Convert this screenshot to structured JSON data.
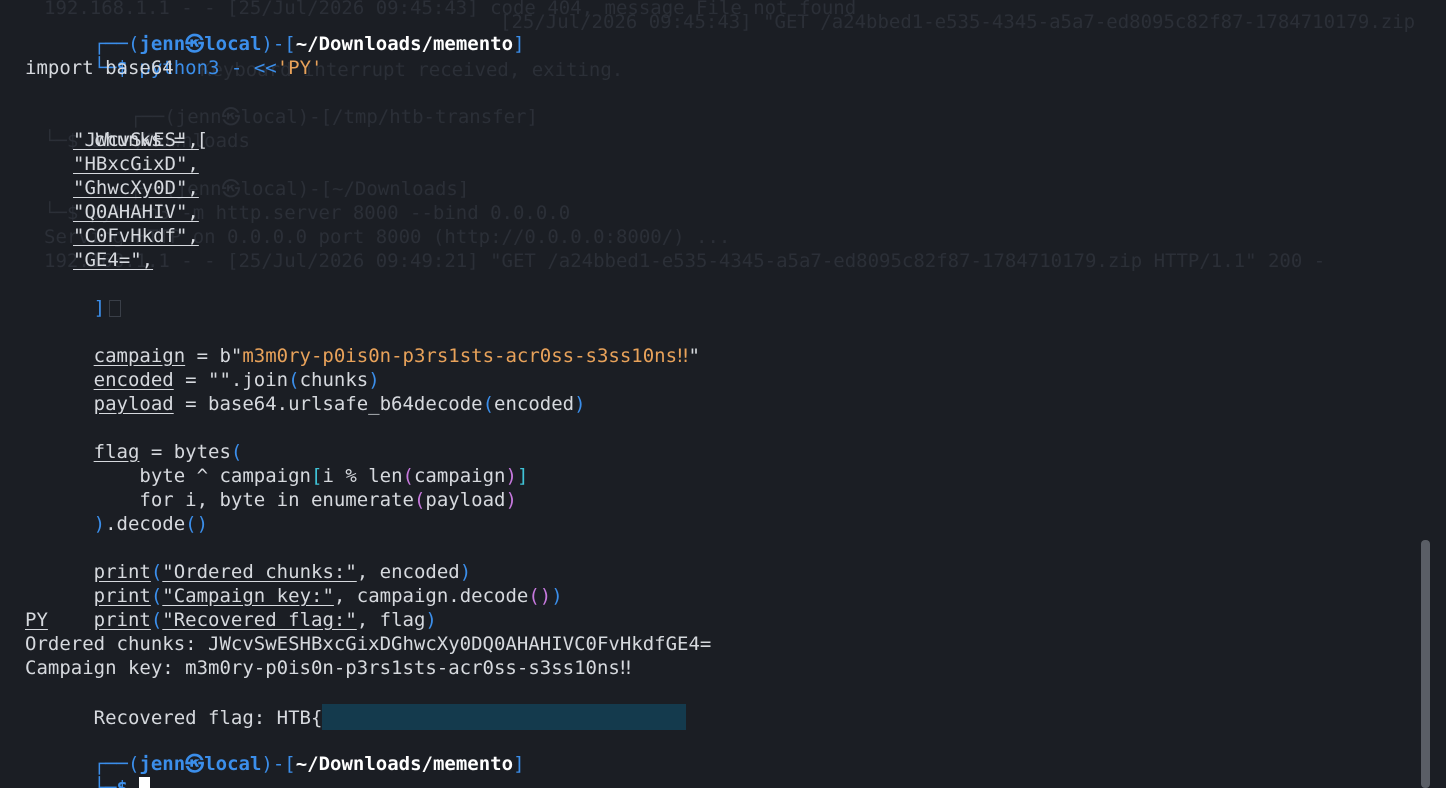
{
  "prompt": {
    "user": "jenn",
    "at_symbol": "㉿",
    "host": "local",
    "path": "~/Downloads/memento",
    "tl": "┌──(",
    "mid": ")-[",
    "end": "]",
    "bl": "└─",
    "dollar": "$"
  },
  "command": {
    "text": " python3 - <<",
    "heredoc": "'PY'"
  },
  "script": {
    "import_line": "import base64",
    "chunks_var": "chunks",
    "eq_open": " = [",
    "chunks": [
      "\"JWcvSwES\",",
      "\"HBxcGixD\",",
      "\"GhwcXy0D\",",
      "\"Q0AHAHIV\",",
      "\"C0FvHkdf\",",
      "\"GE4=\","
    ],
    "close_bracket": "]",
    "campaign_var": "campaign",
    "campaign_eq": " = b\"",
    "campaign_value": "m3m0ry-p0is0n-p3rs1sts-acr0ss-s3ss10ns‼",
    "campaign_close": "\"",
    "encoded_var": "encoded",
    "encoded_eq": " = \"\".join",
    "encoded_args": "chunks",
    "payload_var": "payload",
    "payload_eq": " = base64.urlsafe_b64decode",
    "payload_args": "encoded",
    "flag_var": "flag",
    "flag_eq": " = bytes",
    "line_byte_a": "    byte ^ campaign",
    "line_byte_b": "i % len",
    "line_byte_c": "campaign",
    "line_for_a": "    for i, byte in enumerate",
    "line_for_b": "payload",
    "decode": ".decode",
    "print_fn": "print",
    "print1_str": "\"Ordered chunks:\"",
    "print1_arg": ", encoded",
    "print2_str": "\"Campaign key:\"",
    "print2_arg": ", campaign.decode",
    "print3_str": "\"Recovered flag:\"",
    "print3_arg": ", flag",
    "heredoc_end": "PY"
  },
  "output": {
    "ordered": "Ordered chunks: JWcvSwESHBxcGixDGhwcXy0DQ0AHAHIVC0FvHkdfGE4=",
    "campaign": "Campaign key: m3m0ry-p0is0n-p3rs1sts-acr0ss-s3ss10ns‼",
    "flag_prefix": "Recovered flag: HTB{"
  },
  "ghost_text": {
    "g1": "192.168.1.1 - - [25/Jul/2026 09:45:43] code 404, message File not found",
    "g2": "[25/Jul/2026 09:45:43] \"GET /a24bbed1-e535-4345-a5a7-ed8095c82f87-1784710179.zip HTTP/1.1\" 404 -",
    "g3": "Keyboard interrupt received, exiting.",
    "g4": "┌──(jenn㉿local)-[/tmp/htb-transfer]",
    "g5": "└─$ cd ~/Downloads",
    "g6": "┌──(jenn㉿local)-[~/Downloads]",
    "g7": "└─$ python3 -m http.server 8000 --bind 0.0.0.0",
    "g8": "Serving HTTP on 0.0.0.0 port 8000 (http://0.0.0.0:8000/) ...",
    "g9": "192.168.1.1 - - [25/Jul/2026 09:49:21] \"GET /a24bbed1-e535-4345-a5a7-ed8095c82f87-1784710179.zip HTTP/1.1\" 200 -"
  },
  "colors": {
    "background": "#1b1e24",
    "prompt_blue": "#3b8eea",
    "string_orange": "#e8a25a",
    "redaction": "#143a4d"
  }
}
